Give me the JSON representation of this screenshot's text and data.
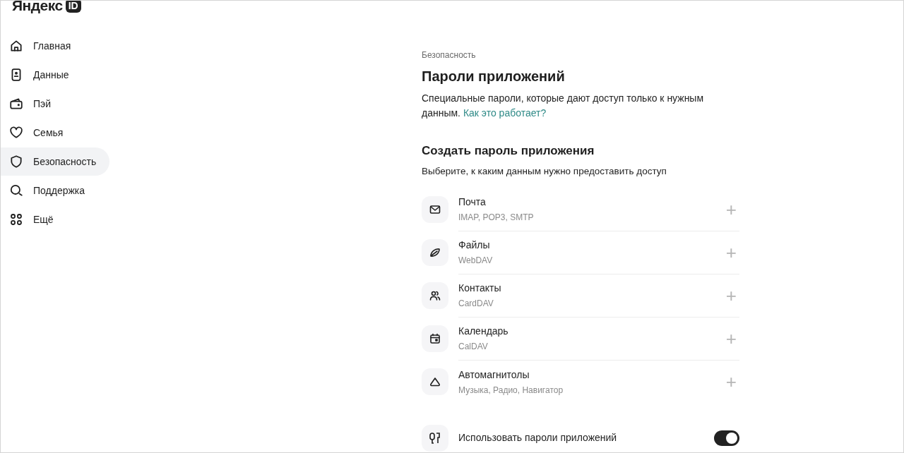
{
  "logo": {
    "text": "Яндекс",
    "badge": "ID"
  },
  "sidebar": {
    "items": [
      {
        "label": "Главная",
        "selected": false
      },
      {
        "label": "Данные",
        "selected": false
      },
      {
        "label": "Пэй",
        "selected": false
      },
      {
        "label": "Семья",
        "selected": false
      },
      {
        "label": "Безопасность",
        "selected": true
      },
      {
        "label": "Поддержка",
        "selected": false
      },
      {
        "label": "Ещё",
        "selected": false
      }
    ]
  },
  "breadcrumb": "Безопасность",
  "title": "Пароли приложений",
  "description": "Специальные пароли, которые дают доступ только к нужным данным.",
  "link": "Как это работает?",
  "section": {
    "title": "Создать пароль приложения",
    "subtitle": "Выберите, к каким данным нужно предоставить доступ"
  },
  "services": [
    {
      "name": "Почта",
      "protocols": "IMAP, POP3, SMTP",
      "action": "+"
    },
    {
      "name": "Файлы",
      "protocols": "WebDAV",
      "action": "+"
    },
    {
      "name": "Контакты",
      "protocols": "CardDAV",
      "action": "+"
    },
    {
      "name": "Календарь",
      "protocols": "CalDAV",
      "action": "+"
    },
    {
      "name": "Автомагнитолы",
      "protocols": "Музыка, Радио, Навигатор",
      "action": "+"
    }
  ],
  "setting": {
    "label": "Использовать пароли приложений",
    "on": true
  }
}
